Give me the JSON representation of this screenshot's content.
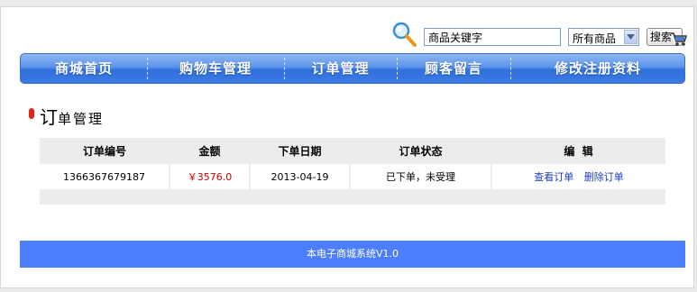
{
  "search": {
    "value": "商品关键字",
    "category_selected": "所有商品",
    "button_label": "搜索"
  },
  "nav": {
    "items": [
      "商城首页",
      "购物车管理",
      "订单管理",
      "顾客留言",
      "修改注册资料"
    ]
  },
  "page": {
    "title_first": "订",
    "title_rest": "单管理"
  },
  "orders_table": {
    "headers": [
      "订单编号",
      "金额",
      "下单日期",
      "订单状态",
      "编  辑"
    ],
    "rows": [
      {
        "order_no": "1366367679187",
        "amount": "￥3576.0",
        "date": "2013-04-19",
        "status": "已下单，未受理",
        "action_view": "查看订单",
        "action_delete": "删除订单"
      }
    ]
  },
  "footer": {
    "text": "本电子商城系统V1.0"
  },
  "colors": {
    "nav": "#3d7ae4",
    "footer": "#4d7efe",
    "amount": "#d00000",
    "link": "#1a3bb8",
    "bullet": "#e2231a"
  }
}
